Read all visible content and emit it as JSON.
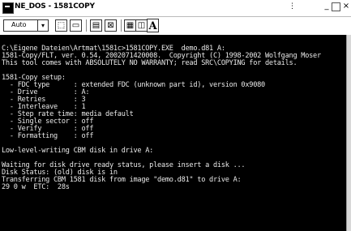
{
  "window": {
    "title": "NE_DOS - 1581COPY",
    "controls": {
      "minimize": "_",
      "maximize": "□",
      "close": "×"
    }
  },
  "toolbar": {
    "font_size_value": "Auto",
    "font_label": "A",
    "icons": [
      "mark-icon",
      "copy-icon",
      "paste-icon",
      "fullscreen-icon",
      "properties-icon",
      "background-icon"
    ]
  },
  "console": {
    "lines": [
      "",
      "C:\\Eigene Dateien\\Artmat\\1581c>1581COPY.EXE  demo.d81 A:",
      "1581-Copy/FLT, ver. 0.54, 2002071420008.  Copyright (C) 1998-2002 Wolfgang Moser",
      "This tool comes with ABSOLUTELY NO WARRANTY; read SRC\\COPYING for details.",
      "",
      "1581-Copy setup:",
      "  - FDC type      : extended FDC (unknown part id), version 0x9080",
      "  - Drive         : A:",
      "  - Retries       : 3",
      "  - Interleave    : 1",
      "  - Step rate time: media default",
      "  - Single sector : off",
      "  - Verify        : off",
      "  - Formatting    : off",
      "",
      "Low-level-writing CBM disk in drive A:",
      "",
      "Waiting for disk drive ready status, please insert a disk ...",
      "Disk Status: (old) disk is in",
      "Transferring CBM 1581 disk from image \"demo.d81\" to drive A:",
      "29 0 w  ETC:  28s"
    ]
  }
}
